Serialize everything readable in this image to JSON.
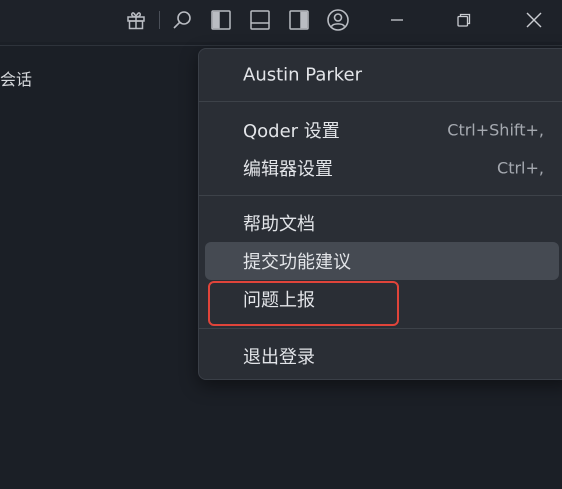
{
  "titlebar": {
    "icons": [
      "gift-icon",
      "search-icon",
      "toggle-primary-sidebar-icon",
      "toggle-panel-icon",
      "toggle-secondary-sidebar-icon",
      "account-icon",
      "minimize-icon",
      "restore-icon",
      "close-icon"
    ]
  },
  "left_pane": {
    "session_label": "会话"
  },
  "menu": {
    "user_name": "Austin Parker",
    "items": [
      {
        "label": "Qoder 设置",
        "shortcut": "Ctrl+Shift+,"
      },
      {
        "label": "编辑器设置",
        "shortcut": "Ctrl+,"
      },
      {
        "label": "帮助文档",
        "shortcut": ""
      },
      {
        "label": "提交功能建议",
        "shortcut": ""
      },
      {
        "label": "问题上报",
        "shortcut": ""
      },
      {
        "label": "退出登录",
        "shortcut": ""
      }
    ],
    "highlighted_index": 3,
    "annotated_index": 4
  },
  "colors": {
    "background": "#1b1f26",
    "menu_background": "#2a2e35",
    "highlight": "#454a52",
    "annotation_red": "#e0443a"
  }
}
